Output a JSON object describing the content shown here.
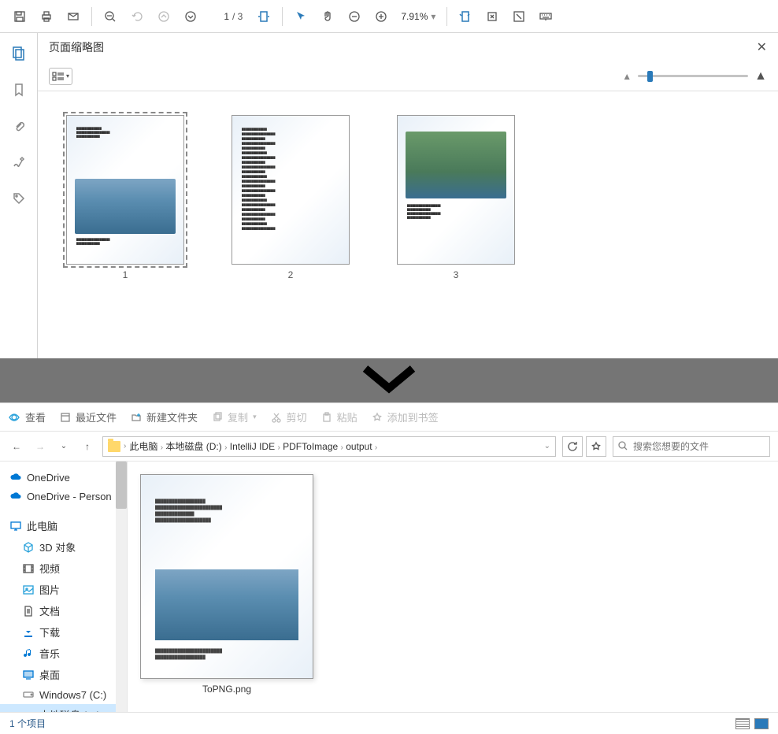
{
  "pdf": {
    "page_current": "1",
    "page_total": "/ 3",
    "zoom_value": "7.91%",
    "panel_title": "页面缩略图",
    "thumbnails": [
      {
        "label": "1",
        "selected": true,
        "imgStyle": "dam"
      },
      {
        "label": "2",
        "selected": false,
        "imgStyle": "text"
      },
      {
        "label": "3",
        "selected": false,
        "imgStyle": "landscape"
      }
    ]
  },
  "explorer": {
    "toolbar": {
      "view": "查看",
      "recent": "最近文件",
      "newfolder": "新建文件夹",
      "copy": "复制",
      "cut": "剪切",
      "paste": "粘贴",
      "bookmark": "添加到书签"
    },
    "breadcrumb": [
      "此电脑",
      "本地磁盘 (D:)",
      "IntelliJ IDE",
      "PDFToImage",
      "output"
    ],
    "search_placeholder": "搜索您想要的文件",
    "tree": [
      {
        "label": "OneDrive",
        "icon": "cloud",
        "color": "#0078d4"
      },
      {
        "label": "OneDrive - Person",
        "icon": "cloud",
        "color": "#0078d4"
      },
      {
        "label": "此电脑",
        "icon": "pc",
        "color": "#0078d4"
      },
      {
        "label": "3D 对象",
        "icon": "cube",
        "color": "#26a0da",
        "indent": true
      },
      {
        "label": "视频",
        "icon": "video",
        "color": "#555",
        "indent": true
      },
      {
        "label": "图片",
        "icon": "image",
        "color": "#26a0da",
        "indent": true
      },
      {
        "label": "文档",
        "icon": "doc",
        "color": "#555",
        "indent": true
      },
      {
        "label": "下载",
        "icon": "download",
        "color": "#0078d4",
        "indent": true
      },
      {
        "label": "音乐",
        "icon": "music",
        "color": "#0078d4",
        "indent": true
      },
      {
        "label": "桌面",
        "icon": "desktop",
        "color": "#0078d4",
        "indent": true
      },
      {
        "label": "Windows7 (C:)",
        "icon": "disk",
        "color": "#888",
        "indent": true
      },
      {
        "label": "本地磁盘 (D:)",
        "icon": "disk",
        "color": "#888",
        "indent": true,
        "selected": true
      }
    ],
    "files": [
      {
        "name": "ToPNG.png"
      }
    ],
    "status": "1 个项目"
  }
}
